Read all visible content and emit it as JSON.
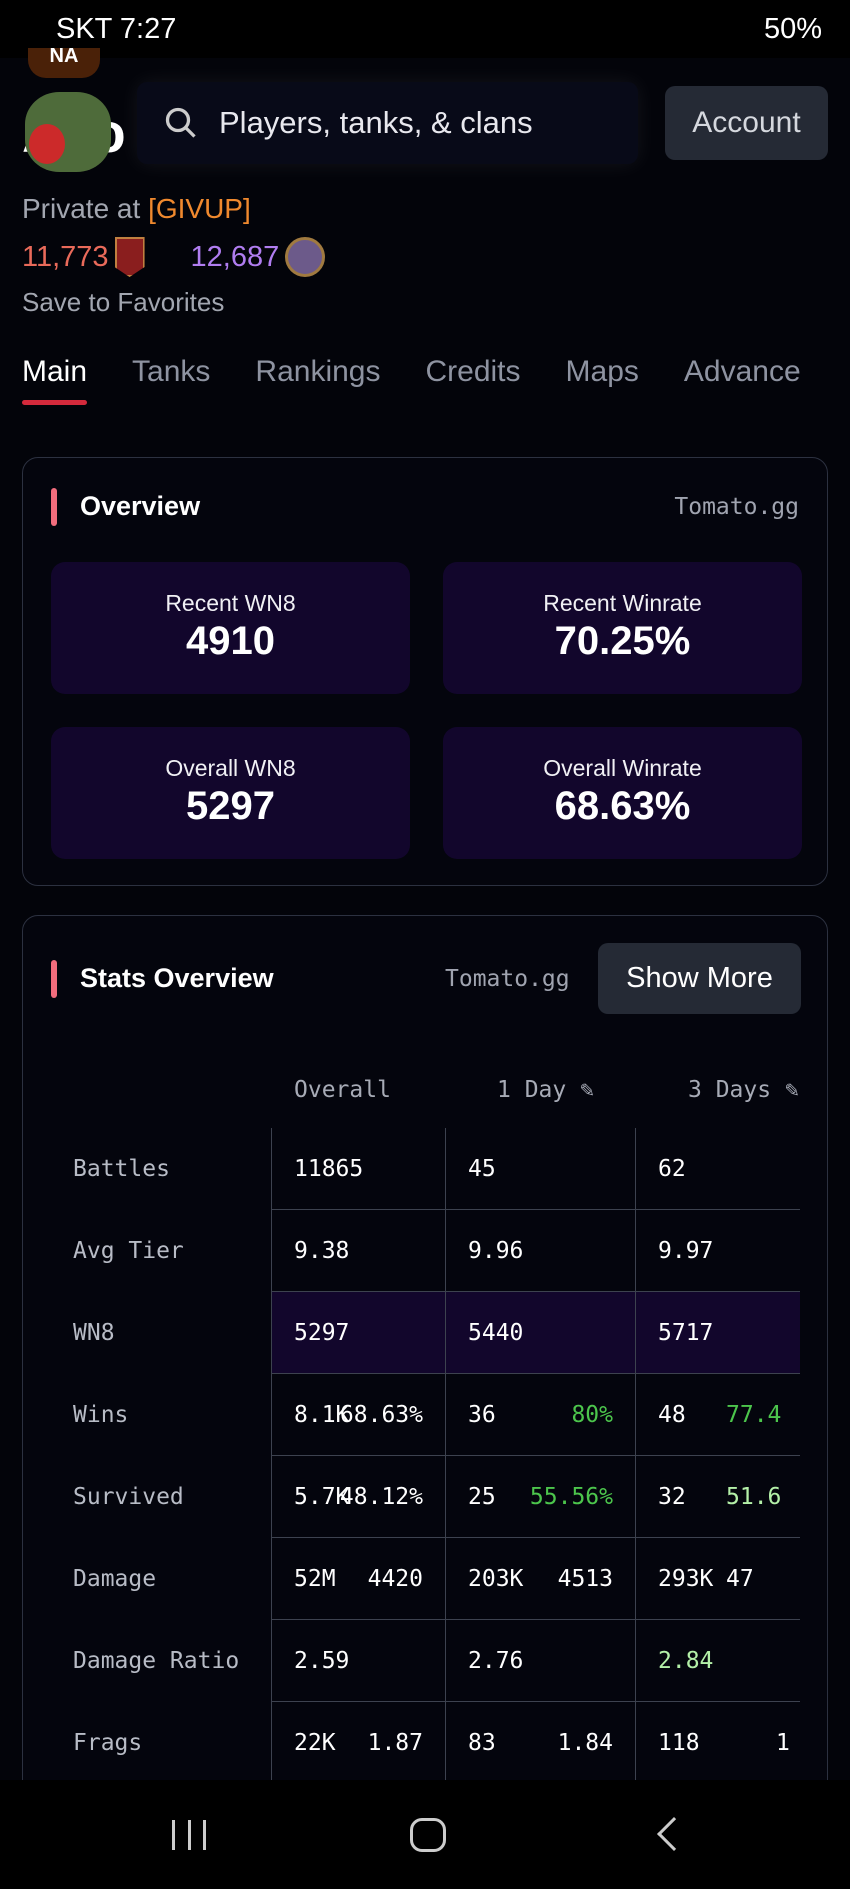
{
  "status_bar": {
    "carrier_time": "SKT 7:27",
    "battery": "50%"
  },
  "header": {
    "region_badge": "NA",
    "player_name_partial": "Ayo",
    "search_placeholder": "Players, tanks, & clans",
    "account_label": "Account"
  },
  "profile": {
    "role": "Private at",
    "clan": "[GIVUP]",
    "rating_1": "11,773",
    "rating_2": "12,687",
    "favorite_label": "Save to Favorites",
    "colors": {
      "clan": "#f0892e",
      "rating_1": "#e96a5a",
      "rating_2": "#b07df0"
    }
  },
  "tabs": [
    {
      "label": "Main",
      "active": true
    },
    {
      "label": "Tanks"
    },
    {
      "label": "Rankings"
    },
    {
      "label": "Credits"
    },
    {
      "label": "Maps"
    },
    {
      "label": "Advance"
    }
  ],
  "overview": {
    "title": "Overview",
    "source": "Tomato.gg",
    "tiles": [
      {
        "label": "Recent WN8",
        "value": "4910"
      },
      {
        "label": "Recent Winrate",
        "value": "70.25%"
      },
      {
        "label": "Overall WN8",
        "value": "5297"
      },
      {
        "label": "Overall Winrate",
        "value": "68.63%"
      }
    ]
  },
  "stats": {
    "title": "Stats Overview",
    "source": "Tomato.gg",
    "show_more": "Show More",
    "columns": [
      "Overall",
      "1 Day",
      "3 Days"
    ],
    "rows": [
      {
        "label": "Battles",
        "cells": [
          [
            "11865",
            ""
          ],
          [
            "45",
            ""
          ],
          [
            "62",
            ""
          ]
        ]
      },
      {
        "label": "Avg Tier",
        "cells": [
          [
            "9.38",
            ""
          ],
          [
            "9.96",
            ""
          ],
          [
            "9.97",
            ""
          ]
        ]
      },
      {
        "label": "WN8",
        "cells": [
          [
            "5297",
            ""
          ],
          [
            "5440",
            ""
          ],
          [
            "5717",
            ""
          ]
        ]
      },
      {
        "label": "Wins",
        "cells": [
          [
            "8.1K",
            "68.63%"
          ],
          [
            "36",
            "80%"
          ],
          [
            "48",
            "77.4"
          ]
        ]
      },
      {
        "label": "Survived",
        "cells": [
          [
            "5.7K",
            "48.12%"
          ],
          [
            "25",
            "55.56%"
          ],
          [
            "32",
            "51.6"
          ]
        ]
      },
      {
        "label": "Damage",
        "cells": [
          [
            "52M",
            "4420"
          ],
          [
            "203K",
            "4513"
          ],
          [
            "293K",
            "47"
          ]
        ]
      },
      {
        "label": "Damage Ratio",
        "cells": [
          [
            "2.59",
            ""
          ],
          [
            "2.76",
            ""
          ],
          [
            "2.84",
            ""
          ]
        ]
      },
      {
        "label": "Frags",
        "cells": [
          [
            "22K",
            "1.87"
          ],
          [
            "83",
            "1.84"
          ],
          [
            "118",
            "1"
          ]
        ]
      }
    ]
  }
}
